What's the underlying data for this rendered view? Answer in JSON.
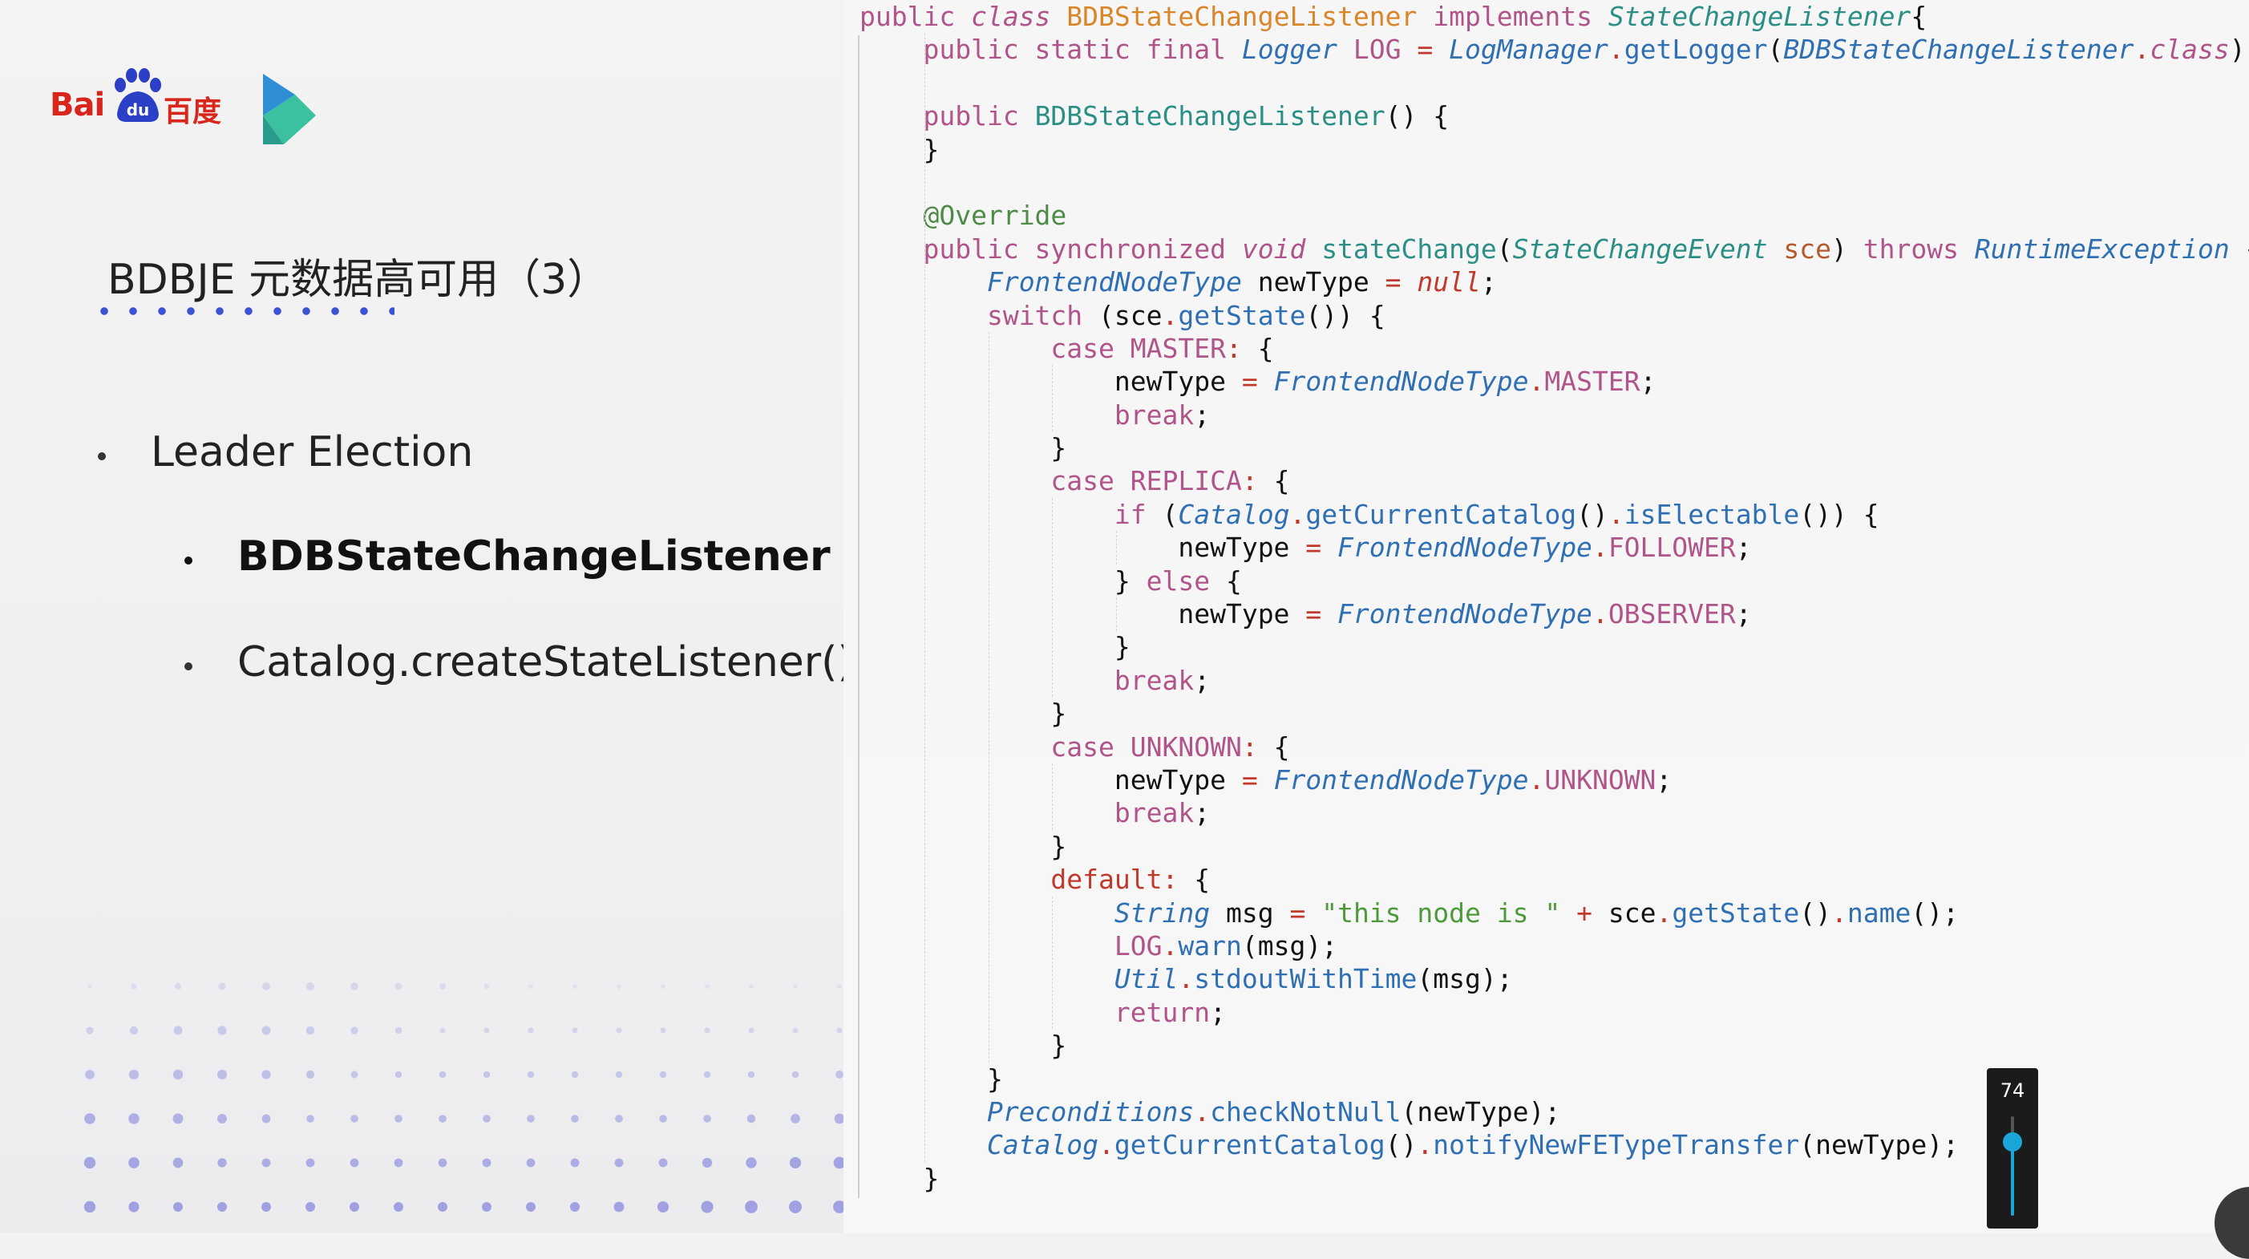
{
  "slide": {
    "logo_bai": "Bai",
    "logo_du": "du",
    "logo_cn": "百度",
    "title": "BDBJE 元数据高可用（3）",
    "bullets": [
      "Leader Election",
      "BDBStateChangeListener",
      "Catalog.createStateListener()"
    ]
  },
  "code": {
    "lines": [
      [
        [
          "kw",
          "public "
        ],
        [
          "kwi",
          "class "
        ],
        [
          "cls",
          "BDBStateChangeListener "
        ],
        [
          "kw",
          "implements "
        ],
        [
          "iface",
          "StateChangeListener"
        ],
        [
          "",
          "{"
        ]
      ],
      [
        [
          "",
          "    "
        ],
        [
          "kw",
          "public static final "
        ],
        [
          "typei",
          "Logger "
        ],
        [
          "const",
          "LOG "
        ],
        [
          "op",
          "= "
        ],
        [
          "typei",
          "LogManager"
        ],
        [
          "op",
          "."
        ],
        [
          "fn",
          "getLogger"
        ],
        [
          "",
          "("
        ],
        [
          "typei",
          "BDBStateChangeListener"
        ],
        [
          "op",
          "."
        ],
        [
          "kwi",
          "class"
        ],
        [
          "",
          ");"
        ]
      ],
      [
        [
          "",
          ""
        ]
      ],
      [
        [
          "",
          "    "
        ],
        [
          "kw",
          "public "
        ],
        [
          "ctor",
          "BDBStateChangeListener"
        ],
        [
          "",
          "() {"
        ]
      ],
      [
        [
          "",
          "    }"
        ]
      ],
      [
        [
          "",
          ""
        ]
      ],
      [
        [
          "",
          "    "
        ],
        [
          "ann",
          "@Override"
        ]
      ],
      [
        [
          "",
          "    "
        ],
        [
          "kw",
          "public synchronized "
        ],
        [
          "kwi",
          "void "
        ],
        [
          "ctor",
          "stateChange"
        ],
        [
          "",
          "("
        ],
        [
          "iface",
          "StateChangeEvent "
        ],
        [
          "var",
          "sce"
        ],
        [
          "",
          ") "
        ],
        [
          "kw",
          "throws "
        ],
        [
          "typei",
          "RuntimeException "
        ],
        [
          "",
          "{"
        ]
      ],
      [
        [
          "",
          "        "
        ],
        [
          "typei",
          "FrontendNodeType "
        ],
        [
          "",
          "newType "
        ],
        [
          "op",
          "= "
        ],
        [
          "nul",
          "null"
        ],
        [
          "",
          ";"
        ]
      ],
      [
        [
          "",
          "        "
        ],
        [
          "kw",
          "switch "
        ],
        [
          "",
          "(sce"
        ],
        [
          "op",
          "."
        ],
        [
          "fn",
          "getState"
        ],
        [
          "",
          "()) {"
        ]
      ],
      [
        [
          "",
          "            "
        ],
        [
          "kw",
          "case "
        ],
        [
          "const",
          "MASTER"
        ],
        [
          "op",
          ": "
        ],
        [
          "",
          "{"
        ]
      ],
      [
        [
          "",
          "                newType "
        ],
        [
          "op",
          "= "
        ],
        [
          "typei",
          "FrontendNodeType"
        ],
        [
          "op",
          "."
        ],
        [
          "const",
          "MASTER"
        ],
        [
          "",
          ";"
        ]
      ],
      [
        [
          "",
          "                "
        ],
        [
          "kw",
          "break"
        ],
        [
          "",
          ";"
        ]
      ],
      [
        [
          "",
          "            }"
        ]
      ],
      [
        [
          "",
          "            "
        ],
        [
          "kw",
          "case "
        ],
        [
          "const",
          "REPLICA"
        ],
        [
          "op",
          ": "
        ],
        [
          "",
          "{"
        ]
      ],
      [
        [
          "",
          "                "
        ],
        [
          "kw",
          "if "
        ],
        [
          "",
          "("
        ],
        [
          "typei",
          "Catalog"
        ],
        [
          "op",
          "."
        ],
        [
          "fn",
          "getCurrentCatalog"
        ],
        [
          "",
          "()"
        ],
        [
          "op",
          "."
        ],
        [
          "fn",
          "isElectable"
        ],
        [
          "",
          "()) {"
        ]
      ],
      [
        [
          "",
          "                    newType "
        ],
        [
          "op",
          "= "
        ],
        [
          "typei",
          "FrontendNodeType"
        ],
        [
          "op",
          "."
        ],
        [
          "const",
          "FOLLOWER"
        ],
        [
          "",
          ";"
        ]
      ],
      [
        [
          "",
          "                } "
        ],
        [
          "kw",
          "else "
        ],
        [
          "",
          "{"
        ]
      ],
      [
        [
          "",
          "                    newType "
        ],
        [
          "op",
          "= "
        ],
        [
          "typei",
          "FrontendNodeType"
        ],
        [
          "op",
          "."
        ],
        [
          "const",
          "OBSERVER"
        ],
        [
          "",
          ";"
        ]
      ],
      [
        [
          "",
          "                }"
        ]
      ],
      [
        [
          "",
          "                "
        ],
        [
          "kw",
          "break"
        ],
        [
          "",
          ";"
        ]
      ],
      [
        [
          "",
          "            }"
        ]
      ],
      [
        [
          "",
          "            "
        ],
        [
          "kw",
          "case "
        ],
        [
          "const",
          "UNKNOWN"
        ],
        [
          "op",
          ": "
        ],
        [
          "",
          "{"
        ]
      ],
      [
        [
          "",
          "                newType "
        ],
        [
          "op",
          "= "
        ],
        [
          "typei",
          "FrontendNodeType"
        ],
        [
          "op",
          "."
        ],
        [
          "const",
          "UNKNOWN"
        ],
        [
          "",
          ";"
        ]
      ],
      [
        [
          "",
          "                "
        ],
        [
          "kw",
          "break"
        ],
        [
          "",
          ";"
        ]
      ],
      [
        [
          "",
          "            }"
        ]
      ],
      [
        [
          "",
          "            "
        ],
        [
          "dflt",
          "default"
        ],
        [
          "op",
          ": "
        ],
        [
          "",
          "{"
        ]
      ],
      [
        [
          "",
          "                "
        ],
        [
          "typei",
          "String "
        ],
        [
          "",
          "msg "
        ],
        [
          "op",
          "= "
        ],
        [
          "str",
          "\"this node is \" "
        ],
        [
          "op",
          "+ "
        ],
        [
          "",
          "sce"
        ],
        [
          "op",
          "."
        ],
        [
          "fn",
          "getState"
        ],
        [
          "",
          "()"
        ],
        [
          "op",
          "."
        ],
        [
          "fn",
          "name"
        ],
        [
          "",
          "();"
        ]
      ],
      [
        [
          "",
          "                "
        ],
        [
          "const",
          "LOG"
        ],
        [
          "op",
          "."
        ],
        [
          "fn",
          "warn"
        ],
        [
          "",
          "(msg);"
        ]
      ],
      [
        [
          "",
          "                "
        ],
        [
          "typei",
          "Util"
        ],
        [
          "op",
          "."
        ],
        [
          "fn",
          "stdoutWithTime"
        ],
        [
          "",
          "(msg);"
        ]
      ],
      [
        [
          "",
          "                "
        ],
        [
          "kw",
          "return"
        ],
        [
          "",
          ";"
        ]
      ],
      [
        [
          "",
          "            }"
        ]
      ],
      [
        [
          "",
          "        }"
        ]
      ],
      [
        [
          "",
          "        "
        ],
        [
          "typei",
          "Preconditions"
        ],
        [
          "op",
          "."
        ],
        [
          "fn",
          "checkNotNull"
        ],
        [
          "",
          "(newType);"
        ]
      ],
      [
        [
          "",
          "        "
        ],
        [
          "typei",
          "Catalog"
        ],
        [
          "op",
          "."
        ],
        [
          "fn",
          "getCurrentCatalog"
        ],
        [
          "",
          "()"
        ],
        [
          "op",
          "."
        ],
        [
          "fn",
          "notifyNewFETypeTransfer"
        ],
        [
          "",
          "(newType);"
        ]
      ],
      [
        [
          "",
          "    }"
        ]
      ]
    ]
  },
  "volume": {
    "value": "74",
    "level": 0.74
  },
  "colors": {
    "accent": "#3a52d6",
    "baidu_red": "#d9261c",
    "slider": "#1aa6d8"
  }
}
